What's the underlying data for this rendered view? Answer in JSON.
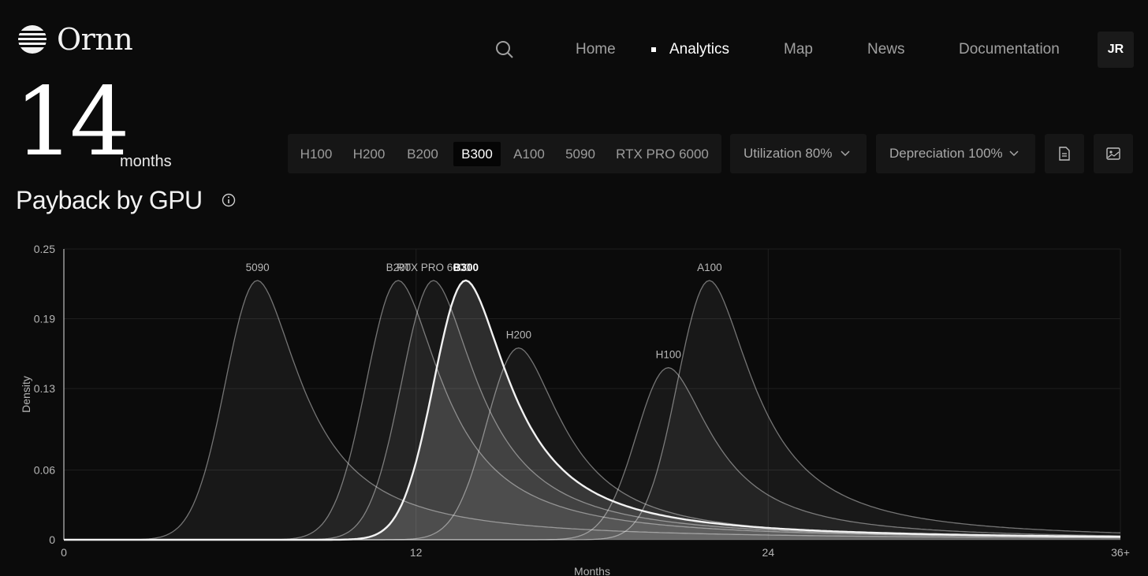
{
  "brand": {
    "name": "Ornn"
  },
  "nav": {
    "search_icon": "search-icon",
    "items": [
      {
        "label": "Home",
        "active": false
      },
      {
        "label": "Analytics",
        "active": true
      },
      {
        "label": "Map",
        "active": false
      },
      {
        "label": "News",
        "active": false
      },
      {
        "label": "Documentation",
        "active": false
      }
    ],
    "avatar": "JR"
  },
  "headline": {
    "value": "14",
    "unit": "months"
  },
  "page_title": "Payback by GPU",
  "gpu_tabs": [
    {
      "label": "H100",
      "active": false
    },
    {
      "label": "H200",
      "active": false
    },
    {
      "label": "B200",
      "active": false
    },
    {
      "label": "B300",
      "active": true
    },
    {
      "label": "A100",
      "active": false
    },
    {
      "label": "5090",
      "active": false
    },
    {
      "label": "RTX PRO 6000",
      "active": false
    }
  ],
  "filters": {
    "utilization": "Utilization 80%",
    "depreciation": "Depreciation 100%"
  },
  "actions": {
    "report_icon": "document-icon",
    "image_icon": "image-icon"
  },
  "colors": {
    "background": "#0b0b0b",
    "panel": "#161616",
    "highlight": "#ffffff",
    "muted": "#9c9c9c"
  },
  "chart_data": {
    "type": "area",
    "xlabel": "Months",
    "ylabel": "Density",
    "xlim": [
      0,
      36
    ],
    "ylim": [
      0,
      0.25
    ],
    "x_ticks": [
      "0",
      "12",
      "24",
      "36+"
    ],
    "y_ticks": [
      "0",
      "0.06",
      "0.13",
      "0.19",
      "0.25"
    ],
    "grid": true,
    "highlighted_series": "B300",
    "series": [
      {
        "name": "5090",
        "peak_x": 6.6,
        "peak_y": 0.223
      },
      {
        "name": "B200",
        "peak_x": 11.4,
        "peak_y": 0.223
      },
      {
        "name": "RTX PRO 6000",
        "peak_x": 12.6,
        "peak_y": 0.223
      },
      {
        "name": "B300",
        "peak_x": 13.7,
        "peak_y": 0.223
      },
      {
        "name": "H200",
        "peak_x": 15.5,
        "peak_y": 0.165
      },
      {
        "name": "H100",
        "peak_x": 20.6,
        "peak_y": 0.148
      },
      {
        "name": "A100",
        "peak_x": 22.0,
        "peak_y": 0.223
      }
    ]
  }
}
